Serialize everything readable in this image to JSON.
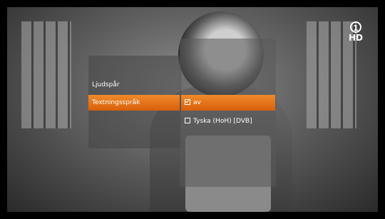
{
  "logo": {
    "channel": "1",
    "quality": "HD"
  },
  "main_menu": {
    "items": [
      {
        "label": "Ljudspår"
      },
      {
        "label": "Textningsspråk"
      }
    ],
    "selected_index": 1
  },
  "submenu": {
    "items": [
      {
        "label": "av",
        "checked": true
      },
      {
        "label": "Tyska (HoH) [DVB]",
        "checked": false
      }
    ],
    "selected_index": 0
  },
  "colors": {
    "accent": "#E8760F"
  }
}
